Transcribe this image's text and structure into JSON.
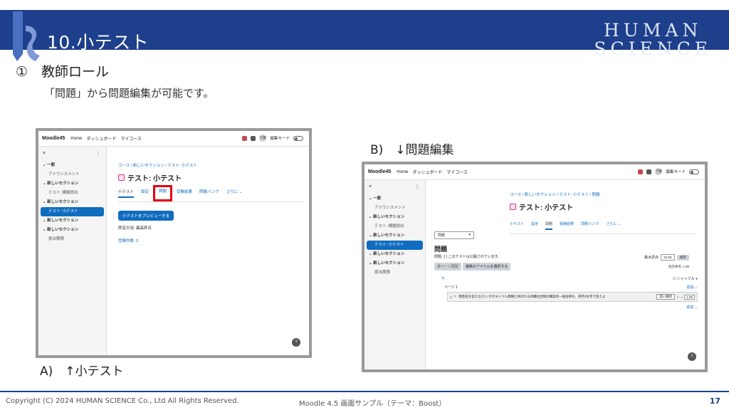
{
  "header": {
    "title": "10.小テスト",
    "logo_line1": "HUMAN",
    "logo_line2": "SCIENCE"
  },
  "section_title": "①　教師ロール",
  "section_subtitle": "「問題」から問題編集が可能です。",
  "screen_a": {
    "nav": {
      "brand": "Moodle45",
      "items": [
        "Home",
        "ダッシュボード",
        "マイコース"
      ],
      "avatar": "テ教",
      "edit_mode": "編集モード"
    },
    "sidebar": {
      "close": "×",
      "menu": "⋮",
      "items": [
        {
          "label": "一般",
          "type": "sec"
        },
        {
          "label": "アナウンスメント",
          "type": "sub"
        },
        {
          "label": "新しいセクション",
          "type": "sec"
        },
        {
          "label": "テスト: 課題提出",
          "type": "sub"
        },
        {
          "label": "新しいセクション",
          "type": "sec"
        },
        {
          "label": "テスト: 小テスト",
          "type": "active"
        },
        {
          "label": "新しいセクション",
          "type": "sec"
        },
        {
          "label": "新しいセクション",
          "type": "sec"
        },
        {
          "label": "提出期限",
          "type": "sub"
        }
      ]
    },
    "breadcrumb": "コース / 新しいセクション / テスト: 小テスト",
    "title": "テスト: 小テスト",
    "tabs": [
      "小テスト",
      "設定",
      "問題",
      "受験結果",
      "問題バンク",
      "さらに ⌄"
    ],
    "preview_button": "小テストをプレビューする",
    "grading_method": "評定方法: 最高評点",
    "attempts_link": "受験件数: 3",
    "help": "?"
  },
  "screen_b": {
    "nav": {
      "brand": "Moodle45",
      "items": [
        "Home",
        "ダッシュボード",
        "マイコース"
      ],
      "avatar": "テ教",
      "edit_mode": "編集モード"
    },
    "sidebar": {
      "close": "×",
      "menu": "⋮",
      "items": [
        {
          "label": "一般",
          "type": "sec"
        },
        {
          "label": "アナウンスメント",
          "type": "sub"
        },
        {
          "label": "新しいセクション",
          "type": "sec"
        },
        {
          "label": "テスト: 課題提出",
          "type": "sub"
        },
        {
          "label": "新しいセクション",
          "type": "sec"
        },
        {
          "label": "テスト: 小テスト",
          "type": "active"
        },
        {
          "label": "新しいセクション",
          "type": "sec"
        },
        {
          "label": "新しいセクション",
          "type": "sec"
        },
        {
          "label": "提出期限",
          "type": "sub"
        }
      ]
    },
    "breadcrumb": "コース / 新しいセクション / テスト: 小テスト / 問題",
    "title": "テスト: 小テスト",
    "tabs": [
      "小テスト",
      "設定",
      "問題",
      "受験結果",
      "問題バンク",
      "さらに ⌄"
    ],
    "select_value": "問題",
    "heading": "問題",
    "info": "問題: 1 | このテストは公開されています。",
    "max_grade_label": "最大評点",
    "max_grade_value": "10.00",
    "save_label": "保存",
    "total_marks": "合計評点: 1.00",
    "repaginate_btn": "改ページ再配",
    "select_multiple_btn": "複数のアイテムを選択する",
    "shuffle_label": "シャッフル",
    "page_label": "ページ 1",
    "add_label": "追加 ⌄",
    "question_text": "物質名を答えなさい  ボタキシリル基類と呼ばれる有機化合物の構造的一般名称を、英字3文字で答えよ",
    "question_num": "1",
    "question_select": "常に最新",
    "question_mark": "1.00",
    "help": "?"
  },
  "captions": {
    "a": "A)　↑小テスト",
    "b": "B)　↓問題編集"
  },
  "footer": {
    "copyright": "Copyright (C) 2024 HUMAN SCIENCE Co., Ltd All Rights Reserved.",
    "center": "Moodle 4.5 画面サンプル（テーマ：Boost）",
    "page": "17"
  },
  "colors": {
    "brand_blue": "#1d3f8c",
    "moodle_blue": "#0f6cbf",
    "highlight_red": "#e60012"
  }
}
